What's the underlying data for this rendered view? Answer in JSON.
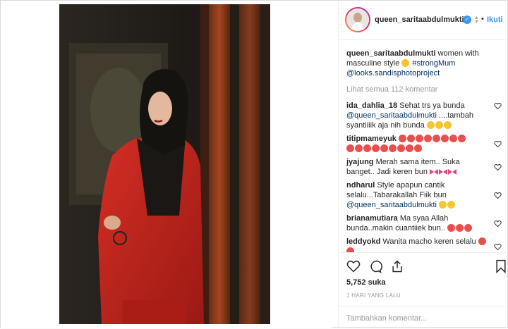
{
  "post": {
    "username": "queen_saritaabdulmukti",
    "separator": "•",
    "follow_label": "Ikuti",
    "caption": {
      "username": "queen_saritaabdulmukti",
      "text": "women with masculine style",
      "hashtag": "#strongMum",
      "mention": "@looks.sandisphotoproject"
    },
    "view_all_comments": "Lihat semua 112 komentar",
    "comments": [
      {
        "username": "ida_dahlia_18",
        "text": "Sehat trs ya bunda",
        "mention": "@queen_saritaabdulmukti",
        "text2": "....tambah syantiiiik aja nih bunda"
      },
      {
        "username": "titipmameyuk",
        "text": ""
      },
      {
        "username": "jyajung",
        "text": "Merah sama item.. Suka banget.. Jadi keren bun"
      },
      {
        "username": "ndharul",
        "text": "Style apapun cantik selalu...Tabarakallah Fiik bun",
        "mention": "@queen_saritaabdulmukti"
      },
      {
        "username": "brianamutiara",
        "text": "Ma syaa Allah bunda..makin cuantiiek bun.."
      },
      {
        "username": "leddyokd",
        "text": "Wanita macho keren selalu"
      }
    ],
    "likes": "5,752 suka",
    "timestamp": "1 HARI YANG LALU",
    "add_comment_placeholder": "Tambahkan komentar...",
    "colors": {
      "link": "#3897f0",
      "muted": "#999999",
      "verified": "#3897f0"
    },
    "icons": [
      "heart-icon",
      "comment-icon",
      "share-icon",
      "bookmark-icon",
      "verified-badge-icon"
    ]
  }
}
